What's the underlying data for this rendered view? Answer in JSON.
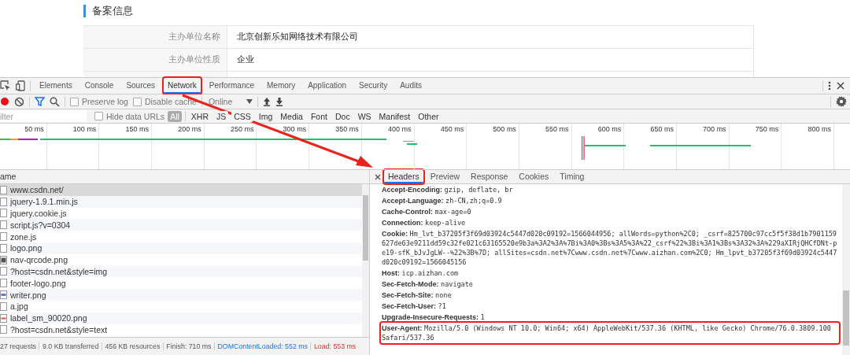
{
  "page": {
    "heading": "备案信息",
    "rows": [
      {
        "label": "主办单位名称",
        "value": "北京创新乐知网络技术有限公司"
      },
      {
        "label": "主办单位性质",
        "value": "企业"
      }
    ]
  },
  "devtools": {
    "tabs": [
      {
        "label": "Elements",
        "selected": false,
        "annotated": false
      },
      {
        "label": "Console",
        "selected": false,
        "annotated": false
      },
      {
        "label": "Sources",
        "selected": false,
        "annotated": false
      },
      {
        "label": "Network",
        "selected": true,
        "annotated": true
      },
      {
        "label": "Performance",
        "selected": false,
        "annotated": false
      },
      {
        "label": "Memory",
        "selected": false,
        "annotated": false
      },
      {
        "label": "Application",
        "selected": false,
        "annotated": false
      },
      {
        "label": "Security",
        "selected": false,
        "annotated": false
      },
      {
        "label": "Audits",
        "selected": false,
        "annotated": false
      }
    ]
  },
  "toolbar": {
    "recording": true,
    "filter_on": true,
    "checkboxes": [
      {
        "label": "Preserve log",
        "checked": false
      },
      {
        "label": "Disable cache",
        "checked": false
      }
    ],
    "throttle": "Online"
  },
  "filter_bar": {
    "placeholder": "ilter",
    "hide_data_urls": {
      "label": "Hide data URLs",
      "checked": false
    },
    "types": [
      {
        "label": "All",
        "selected": true
      },
      {
        "label": "XHR",
        "selected": false
      },
      {
        "label": "JS",
        "selected": false
      },
      {
        "label": "CSS",
        "selected": false
      },
      {
        "label": "Img",
        "selected": false
      },
      {
        "label": "Media",
        "selected": false
      },
      {
        "label": "Font",
        "selected": false
      },
      {
        "label": "Doc",
        "selected": false
      },
      {
        "label": "WS",
        "selected": false
      },
      {
        "label": "Manifest",
        "selected": false
      },
      {
        "label": "Other",
        "selected": false
      }
    ]
  },
  "timeline": {
    "ticks": [
      "50 ms",
      "100 ms",
      "150 ms",
      "200 ms",
      "250 ms",
      "300 ms",
      "350 ms",
      "400 ms",
      "450 ms",
      "500 ms",
      "550 ms",
      "600 ms",
      "650 ms",
      "700 ms",
      "750 ms",
      "800 ms"
    ]
  },
  "requests": {
    "column": "ame",
    "rows": [
      {
        "name": "www.csdn.net/",
        "kind": "doc",
        "selected": true
      },
      {
        "name": "jquery-1.9.1.min.js",
        "kind": "doc",
        "selected": false
      },
      {
        "name": "jquery.cookie.js",
        "kind": "doc",
        "selected": false
      },
      {
        "name": "script.js?v=0304",
        "kind": "doc",
        "selected": false
      },
      {
        "name": "zone.js",
        "kind": "doc",
        "selected": false
      },
      {
        "name": "logo.png",
        "kind": "doc",
        "selected": false
      },
      {
        "name": "nav-qrcode.png",
        "kind": "qr",
        "selected": false
      },
      {
        "name": "?host=csdn.net&style=img",
        "kind": "doc",
        "selected": false
      },
      {
        "name": "footer-logo.png",
        "kind": "doc",
        "selected": false
      },
      {
        "name": "writer.png",
        "kind": "image",
        "selected": false
      },
      {
        "name": "a.jpg",
        "kind": "doc",
        "selected": false
      },
      {
        "name": "label_sm_90020.png",
        "kind": "label",
        "selected": false
      },
      {
        "name": "?host=csdn.net&style=text",
        "kind": "doc",
        "selected": false
      }
    ]
  },
  "status_bar": [
    {
      "text": "27 requests",
      "kind": "plain"
    },
    {
      "text": "9.0 KB transferred",
      "kind": "plain"
    },
    {
      "text": "456 KB resources",
      "kind": "plain"
    },
    {
      "text": "Finish: 710 ms",
      "kind": "plain"
    },
    {
      "text": "DOMContentLoaded: 552 ms",
      "kind": "dom"
    },
    {
      "text": "Load: 553 ms",
      "kind": "load"
    }
  ],
  "details": {
    "tabs": [
      {
        "label": "Headers",
        "selected": true,
        "annotated": true
      },
      {
        "label": "Preview",
        "selected": false,
        "annotated": false
      },
      {
        "label": "Response",
        "selected": false,
        "annotated": false
      },
      {
        "label": "Cookies",
        "selected": false,
        "annotated": false
      },
      {
        "label": "Timing",
        "selected": false,
        "annotated": false
      }
    ],
    "headers": [
      {
        "name": "Accept-Encoding:",
        "value": "gzip, deflate, br",
        "annotated": false
      },
      {
        "name": "Accept-Language:",
        "value": "zh-CN,zh;q=0.9",
        "annotated": false
      },
      {
        "name": "Cache-Control:",
        "value": "max-age=0",
        "annotated": false
      },
      {
        "name": "Connection:",
        "value": "keep-alive",
        "annotated": false
      },
      {
        "name": "Cookie:",
        "value": "Hm_lvt_b37205f3f69d03924c5447d020c09192=1566044956; allWords=python%2C0; _csrf=825700c97cc5f5f38d1b7901159627de63e9211dd59c32fe021c63165520e9b3a%3A2%3A%7Bi%3A0%3Bs%3A5%3A%22_csrf%22%3Bi%3A1%3Bs%3A32%3A%229aXIRjQHCfDNt-pe19-sfK_bJvJgLW--%22%3B%7D; allSites=csdn.net%7Cwww.csdn.net%7Cwww.aizhan.com%2C0; Hm_lpvt_b37205f3f69d03924c5447d020c09192=1566045156",
        "annotated": false
      },
      {
        "name": "Host:",
        "value": "icp.aizhan.com",
        "annotated": false
      },
      {
        "name": "Sec-Fetch-Mode:",
        "value": "navigate",
        "annotated": false
      },
      {
        "name": "Sec-Fetch-Site:",
        "value": "none",
        "annotated": false
      },
      {
        "name": "Sec-Fetch-User:",
        "value": "?1",
        "annotated": false
      },
      {
        "name": "Upgrade-Insecure-Requests:",
        "value": "1",
        "annotated": false
      },
      {
        "name": "User-Agent:",
        "value": "Mozilla/5.0 (Windows NT 10.0; Win64; x64) AppleWebKit/537.36 (KHTML, like Gecko) Chrome/76.0.3809.100 Safari/537.36",
        "annotated": true
      }
    ]
  }
}
